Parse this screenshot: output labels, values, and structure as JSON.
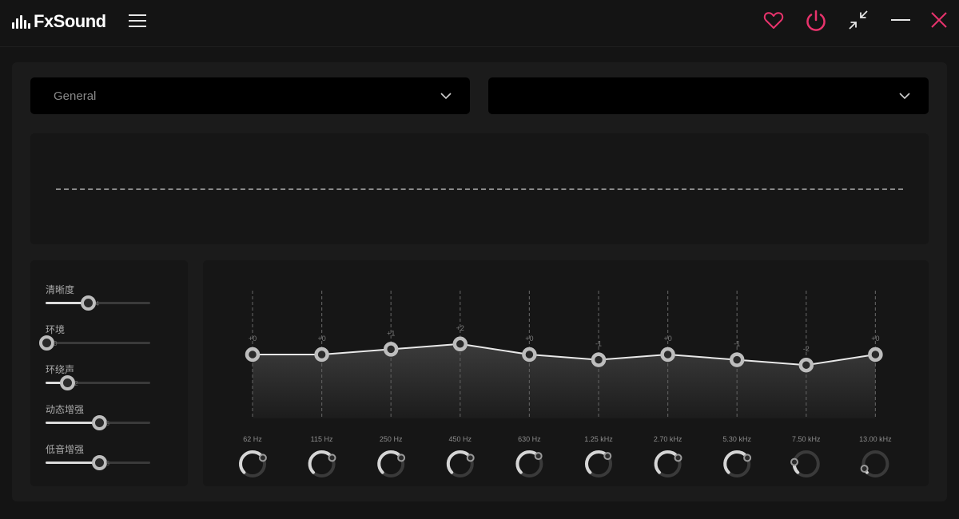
{
  "app": {
    "name": "FxSound"
  },
  "titlebar": {
    "icons": [
      "menu-icon",
      "heart-icon",
      "power-icon",
      "collapse-icon",
      "minimize-icon",
      "close-icon"
    ],
    "accent_color": "#e8336c"
  },
  "dropdowns": [
    {
      "value": "General"
    },
    {
      "value": ""
    }
  ],
  "effects": [
    {
      "label": "清晰度",
      "value": 4,
      "fraction": 0.4
    },
    {
      "label": "环境",
      "value": 0,
      "fraction": 0.0
    },
    {
      "label": "环绕声",
      "value": 2,
      "fraction": 0.2
    },
    {
      "label": "动态增强",
      "value": 5,
      "fraction": 0.5
    },
    {
      "label": "低音增强",
      "value": 5,
      "fraction": 0.5
    }
  ],
  "equalizer": {
    "bands": [
      {
        "freq": "62 Hz",
        "gain": "+0",
        "value": 0,
        "dial": 0.72
      },
      {
        "freq": "115 Hz",
        "gain": "+0",
        "value": 0,
        "dial": 0.72
      },
      {
        "freq": "250 Hz",
        "gain": "+1",
        "value": 1,
        "dial": 0.72
      },
      {
        "freq": "450 Hz",
        "gain": "+2",
        "value": 2,
        "dial": 0.72
      },
      {
        "freq": "630 Hz",
        "gain": "+0",
        "value": 0,
        "dial": 0.68
      },
      {
        "freq": "1.25 kHz",
        "gain": "-1",
        "value": -1,
        "dial": 0.68
      },
      {
        "freq": "2.70 kHz",
        "gain": "+0",
        "value": 0,
        "dial": 0.72
      },
      {
        "freq": "5.30 kHz",
        "gain": "-1",
        "value": -1,
        "dial": 0.72
      },
      {
        "freq": "7.50 kHz",
        "gain": "-2",
        "value": -2,
        "dial": 0.2
      },
      {
        "freq": "13.00 kHz",
        "gain": "+0",
        "value": 0,
        "dial": 0.08
      }
    ]
  }
}
